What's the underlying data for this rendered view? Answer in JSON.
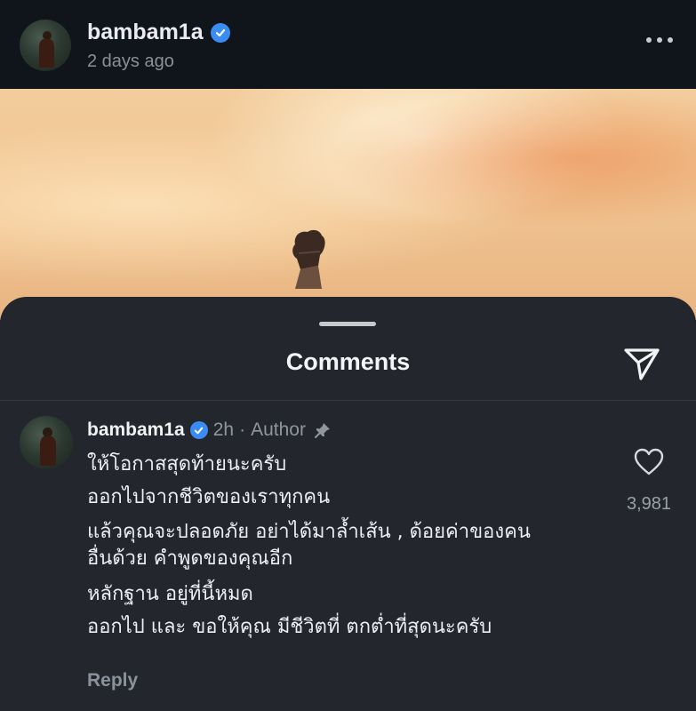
{
  "post": {
    "username": "bambam1a",
    "time": "2 days ago"
  },
  "comments_sheet": {
    "title": "Comments"
  },
  "comment": {
    "username": "bambam1a",
    "time": "2h",
    "separator": "·",
    "author_label": "Author",
    "lines": [
      "ให้โอกาสสุดท้ายนะครับ",
      "ออกไปจากชีวิตของเราทุกคน",
      "แล้วคุณจะปลอดภัย อย่าได้มาล้ำเส้น , ด้อยค่าของคน",
      "อื่นด้วย คำพูดของคุณอีก",
      "หลักฐาน อยู่ที่นี้หมด",
      "ออกไป และ ขอให้คุณ มีชีวิตที่ ตกต่ำที่สุดนะครับ"
    ],
    "like_count": "3,981",
    "reply_label": "Reply"
  },
  "icons": {
    "verified": "verified-badge-icon",
    "more": "more-options-icon",
    "share": "send-icon",
    "pin": "pin-icon",
    "like": "heart-icon"
  },
  "colors": {
    "verified": "#3b8cf2",
    "sheet_background": "#23262d",
    "header_background": "#10141b",
    "muted_text": "#8a9099"
  }
}
